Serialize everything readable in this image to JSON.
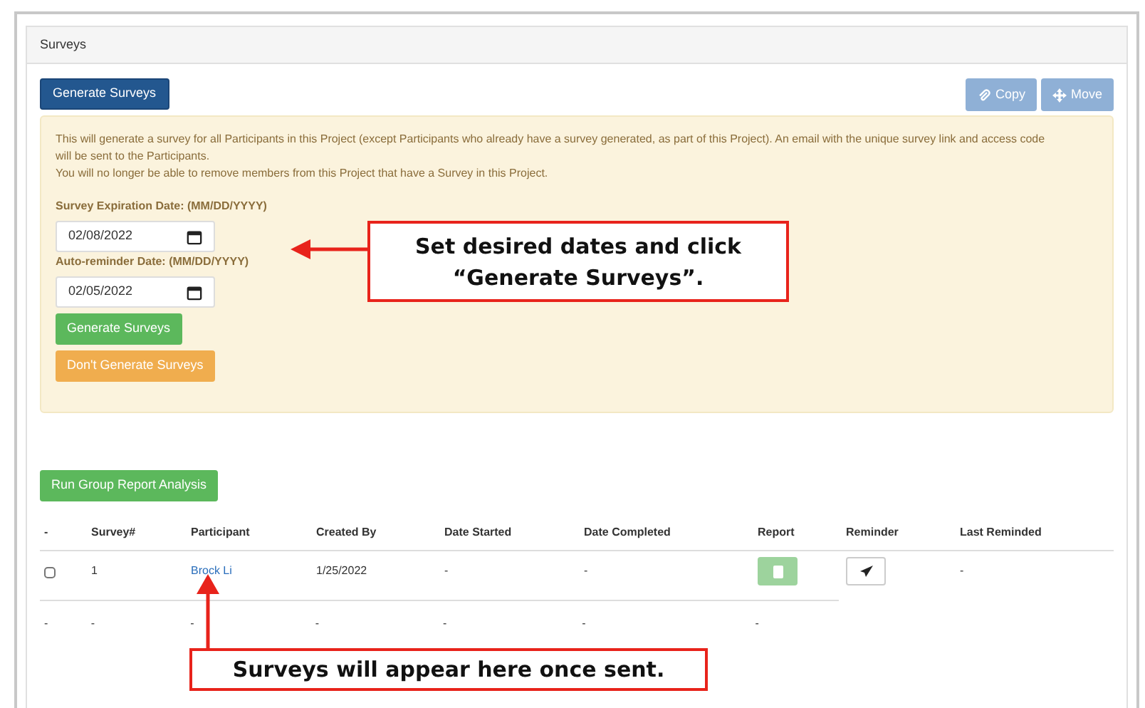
{
  "panel": {
    "title": "Surveys"
  },
  "toolbar": {
    "primary": "Generate Surveys",
    "actions": [
      {
        "label": "Copy",
        "kind": "copy"
      },
      {
        "label": "Move",
        "kind": "move"
      }
    ]
  },
  "notice": {
    "lines": [
      "This will generate a survey for all Participants in this Project (except Participants who already have a survey generated, as part of this Project). An email with the unique survey link and access code will be sent to the Participants.",
      "You will no longer be able to remove members from this Project that have a Survey in this Project."
    ],
    "fields": [
      {
        "label": "Survey Expiration Date: (MM/DD/YYYY)",
        "value": "02/08/2022"
      },
      {
        "label": "Auto-reminder Date: (MM/DD/YYYY)",
        "value": "02/05/2022"
      }
    ],
    "buttons": [
      {
        "label": "Generate Surveys",
        "kind": "success"
      },
      {
        "label": "Don't Generate Surveys",
        "kind": "warning"
      }
    ]
  },
  "analysis_button": "Run Group Report Analysis",
  "table": {
    "columns": [
      "-",
      "Survey#",
      "Participant",
      "Created By",
      "Date Started",
      "Date Completed",
      "Report",
      "Reminder",
      "Last Reminded"
    ],
    "rows": [
      {
        "checked": false,
        "survey": "1",
        "participant": "Brock Li",
        "created_by": "1/25/2022",
        "date_started": "-",
        "date_completed": "-",
        "last_reminded": "-"
      }
    ],
    "footer": [
      "-",
      "-",
      "-",
      "-",
      "-",
      "-",
      "-"
    ]
  },
  "callouts": [
    {
      "text": "Set desired dates and click “Generate Surveys”.",
      "kind": "left"
    },
    {
      "text": "Surveys will appear here once sent.",
      "kind": "up"
    }
  ]
}
